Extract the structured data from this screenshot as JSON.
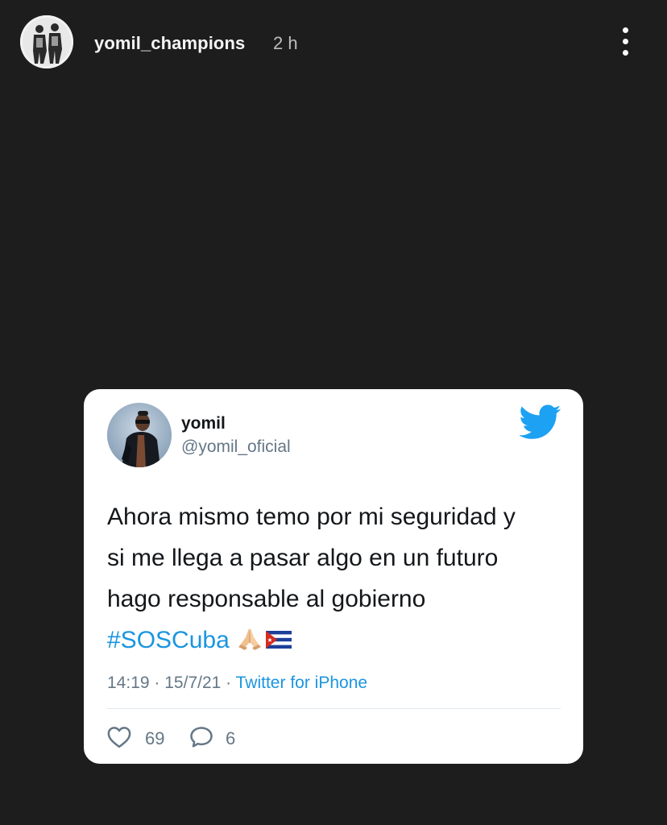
{
  "header": {
    "username": "yomil_champions",
    "time": "2 h",
    "menu_icon": "more-vertical-icon"
  },
  "tweet": {
    "name": "yomil",
    "handle": "@yomil_oficial",
    "text_lines": [
      "Ahora mismo temo por mi seguridad y",
      "si me llega a pasar algo en un futuro",
      "hago responsable al gobierno"
    ],
    "hashtag": "#SOSCuba",
    "emojis": [
      "folded-hands-emoji",
      "cuba-flag-emoji"
    ],
    "time": "14:19",
    "date": "15/7/21",
    "separator": "·",
    "source": "Twitter for iPhone",
    "likes": "69",
    "replies": "6",
    "colors": {
      "link": "#1b95e0",
      "twitter_blue": "#1da1f2",
      "secondary_text": "#657786"
    }
  }
}
